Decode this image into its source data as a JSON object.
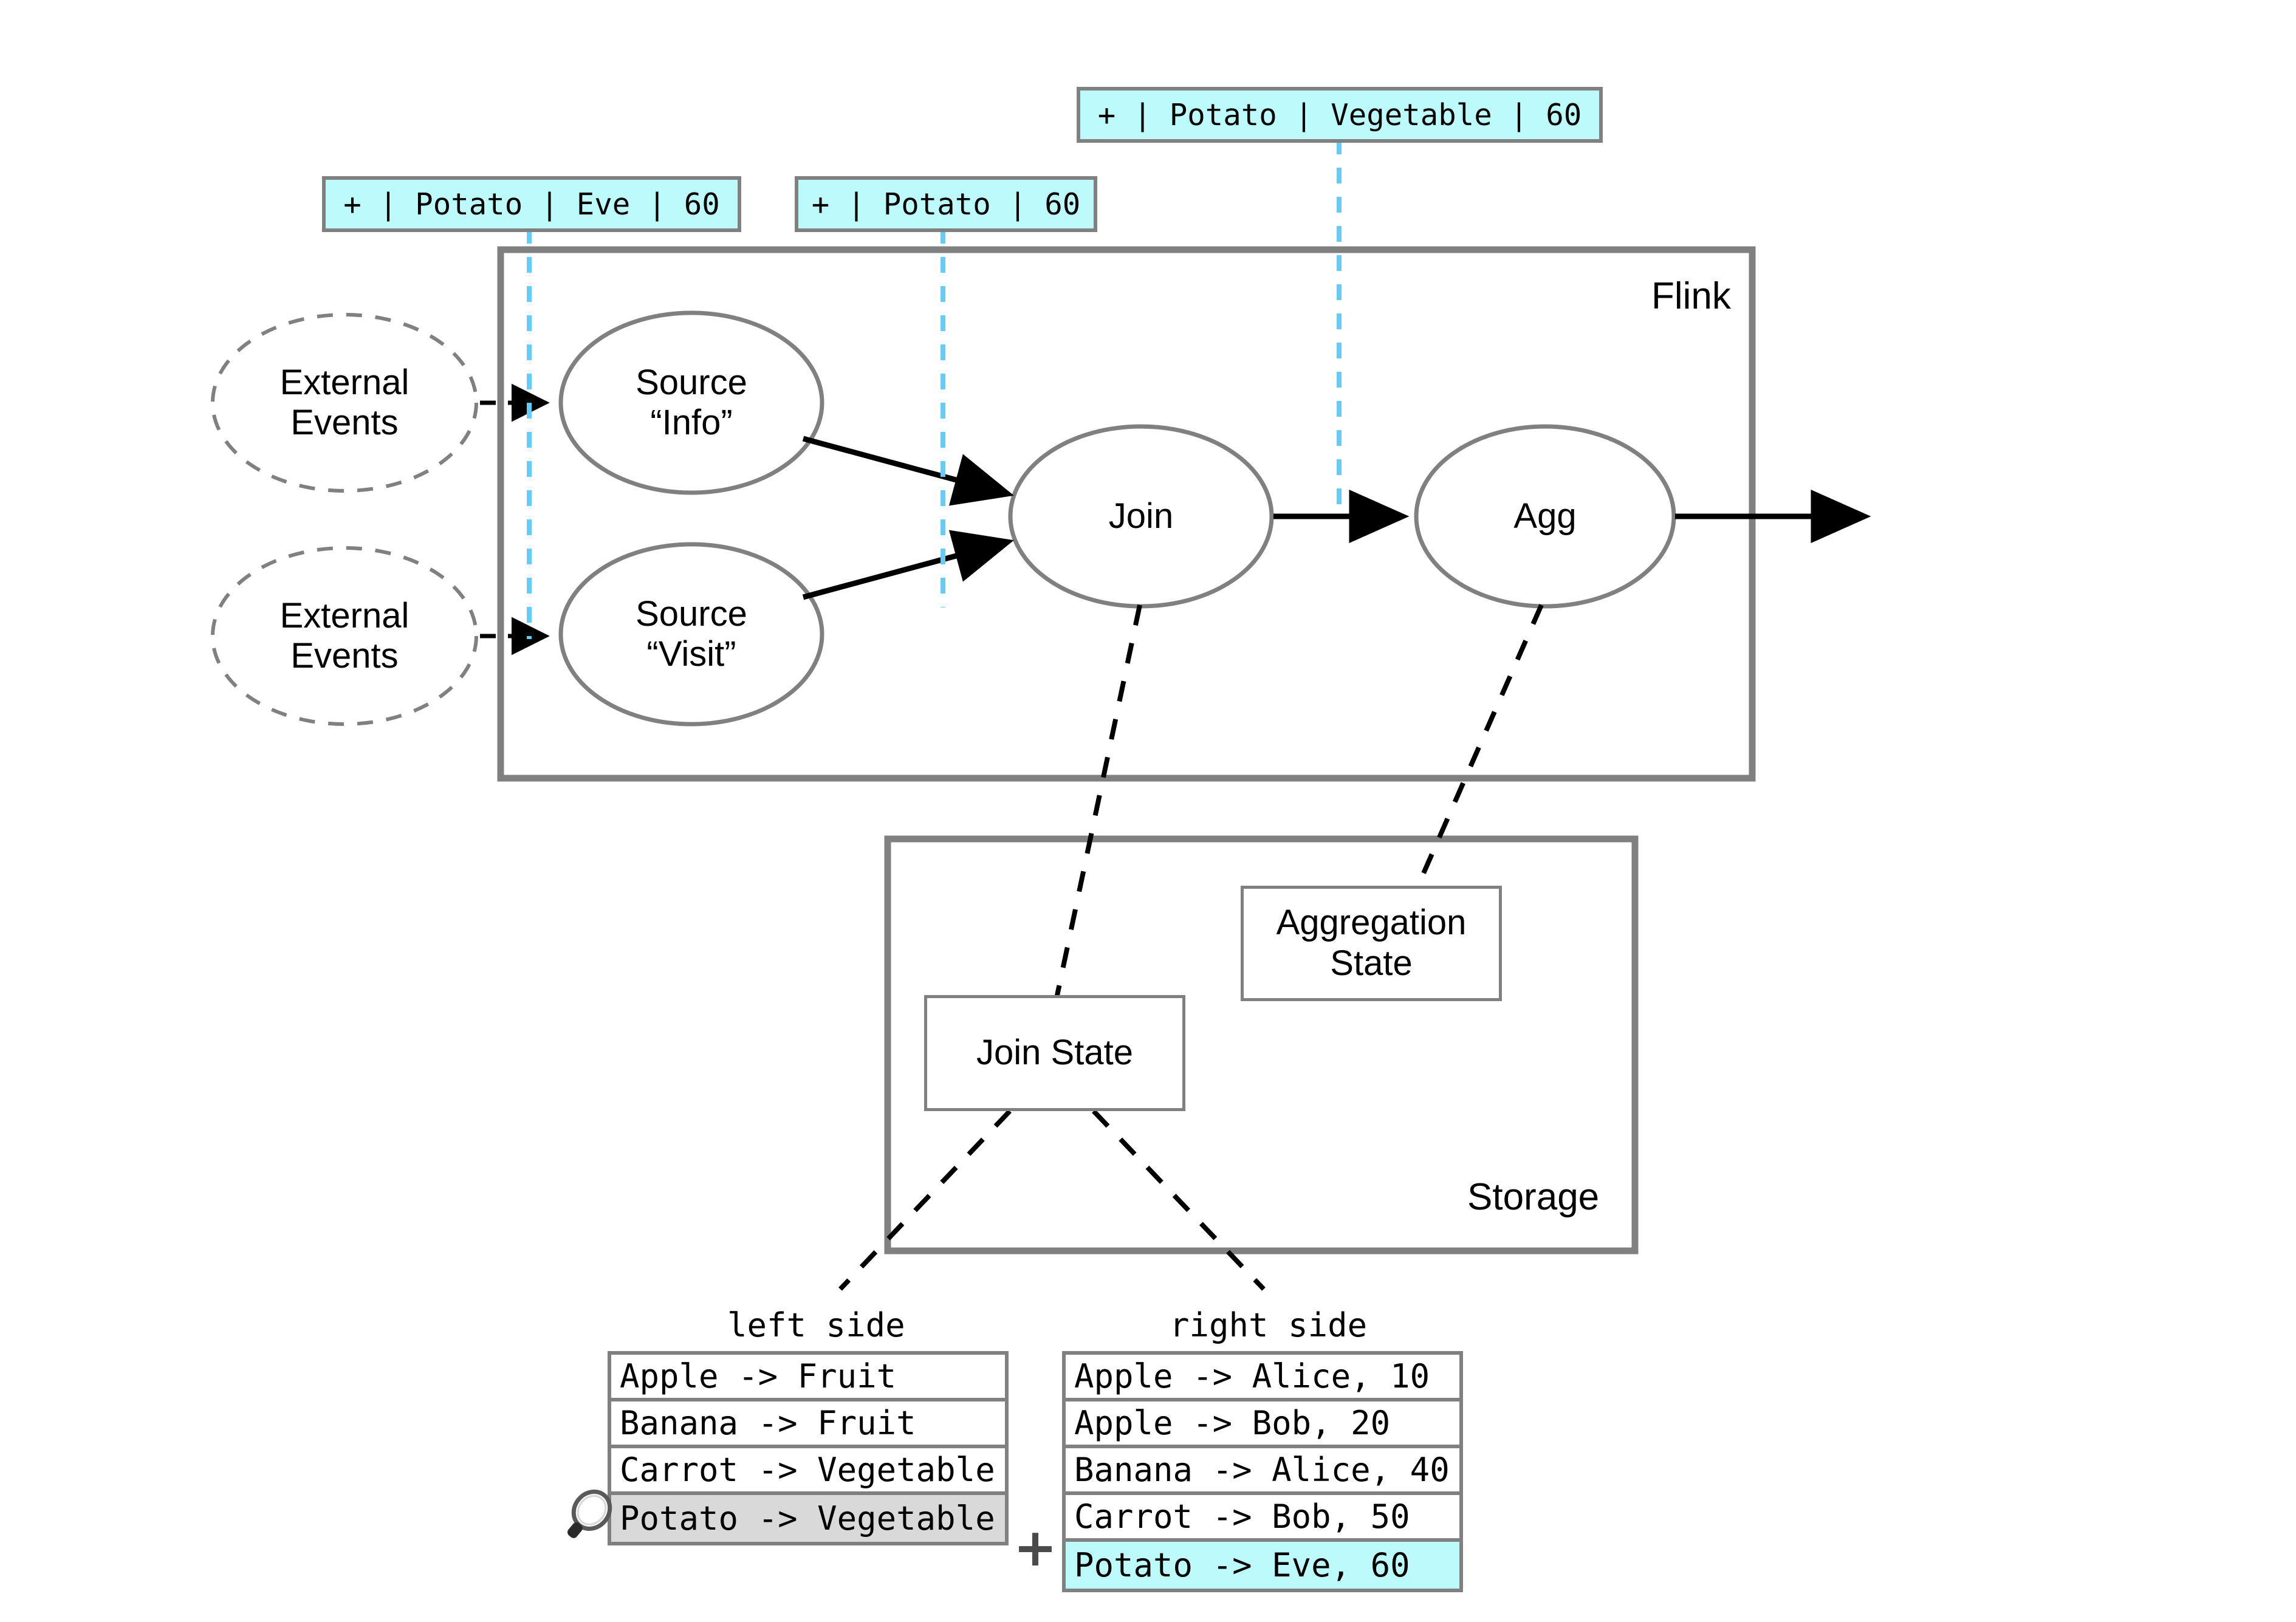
{
  "diagram": {
    "title_flink": "Flink",
    "title_storage": "Storage"
  },
  "event_labels": [
    {
      "id": "evt-source-info",
      "text": "+ | Potato | Eve | 60"
    },
    {
      "id": "evt-source-visit",
      "text": "+ | Potato | 60"
    },
    {
      "id": "evt-join-output",
      "text": "+ | Potato | Vegetable | 60"
    }
  ],
  "external": {
    "top_label": "External\nEvents",
    "bottom_label": "External\nEvents"
  },
  "nodes": {
    "source_info": "Source\n“Info”",
    "source_visit": "Source\n“Visit”",
    "join": "Join",
    "agg": "Agg"
  },
  "storage": {
    "join_state": "Join State",
    "aggregation_state": "Aggregation\nState"
  },
  "tables": {
    "left": {
      "caption": "left side",
      "rows": [
        {
          "text": "Apple -> Fruit",
          "highlight": "none"
        },
        {
          "text": "Banana -> Fruit",
          "highlight": "none"
        },
        {
          "text": "Carrot -> Vegetable",
          "highlight": "none"
        },
        {
          "text": "Potato -> Vegetable",
          "highlight": "gray"
        }
      ],
      "marker_icon": "magnifier-icon"
    },
    "right": {
      "caption": "right side",
      "rows": [
        {
          "text": "Apple -> Alice, 10",
          "highlight": "none"
        },
        {
          "text": "Apple -> Bob, 20",
          "highlight": "none"
        },
        {
          "text": "Banana -> Alice, 40",
          "highlight": "none"
        },
        {
          "text": "Carrot -> Bob, 50",
          "highlight": "none"
        },
        {
          "text": "Potato -> Eve, 60",
          "highlight": "cyan"
        }
      ],
      "marker_icon": "plus-icon",
      "marker_glyph": "+"
    }
  },
  "colors": {
    "highlight_cyan": "#BDFAFC",
    "highlight_gray": "#D9D9D9",
    "border_gray": "#808080",
    "trace_cyan": "#66CCF5",
    "line_black": "#000000"
  }
}
